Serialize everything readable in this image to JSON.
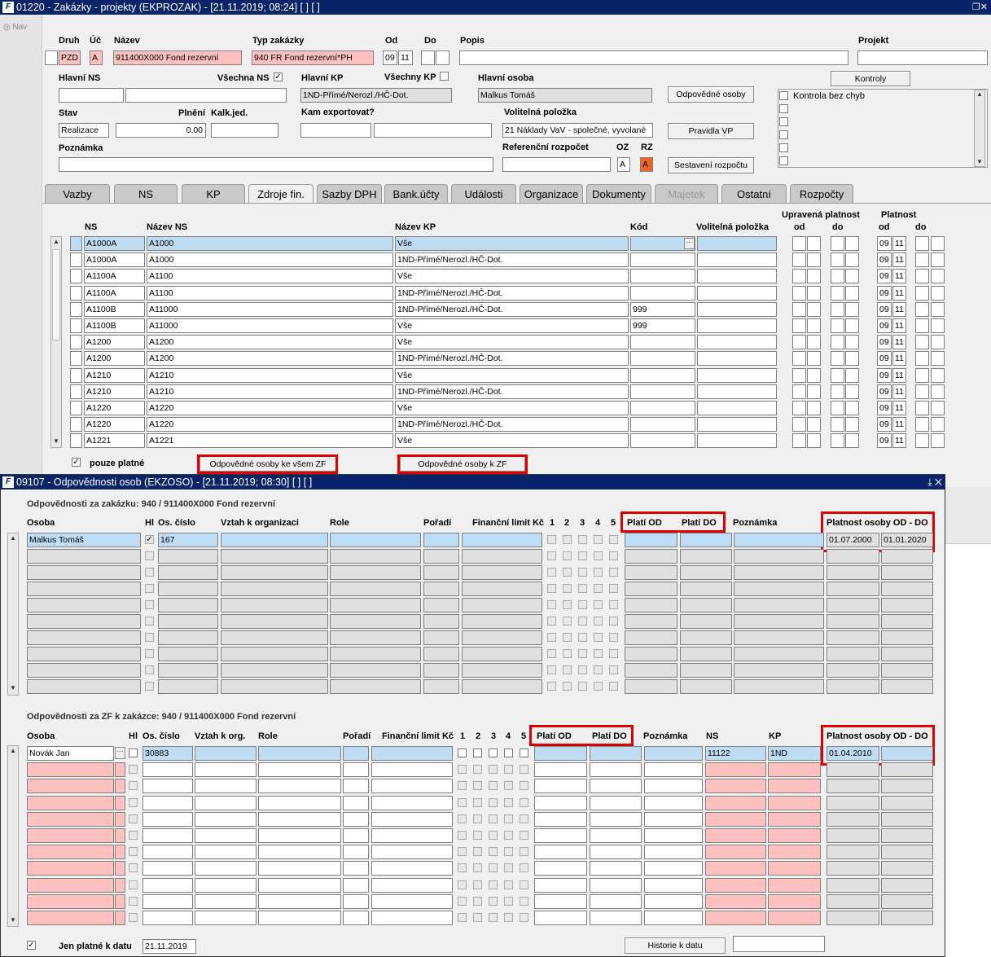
{
  "main_window": {
    "title": "01220 - Zakázky - projekty (EKPROZAK) - [21.11.2019; 08:24]  [ ]  [ ]",
    "nav": "Nav",
    "labels": {
      "druh": "Druh",
      "uc": "Úč",
      "nazev": "Název",
      "typ": "Typ zakázky",
      "od": "Od",
      "do": "Do",
      "popis": "Popis",
      "projekt": "Projekt",
      "hlavni_ns": "Hlavní NS",
      "vsechna_ns": "Všechna NS",
      "hlavni_kp": "Hlavní KP",
      "vsechny_kp": "Všechny KP",
      "hlavni_osoba": "Hlavní osoba",
      "stav": "Stav",
      "plneni": "Plnění",
      "kalk": "Kalk.jed.",
      "kam": "Kam exportovat?",
      "volitelna": "Volitelná položka",
      "poznamka": "Poznámka",
      "ref": "Referenční rozpočet",
      "oz": "OZ",
      "rz": "RZ",
      "kontrola": "Kontrola bez chyb",
      "pouze": "pouze platné"
    },
    "values": {
      "druh": "PZD",
      "uc": "A",
      "nazev": "911400X000 Fond rezervní",
      "typ": "940 FR Fond rezervní*PH",
      "od_d": "09",
      "od_m": "11",
      "hlavni_kp": "1ND-Přímé/Nerozl./HČ-Dot.",
      "hlavni_osoba": "Malkus Tomáš",
      "stav": "Realizace",
      "plneni": "0.00",
      "volitelna": "21 Náklady VaV - společné, vyvolané",
      "oz": "A",
      "rz": "A"
    },
    "buttons": {
      "kontroly": "Kontroly",
      "odpovedne": "Odpovědné osoby",
      "pravidla": "Pravidla VP",
      "sestaveni": "Sestavení rozpočtu",
      "k_vsem": "Odpovědné osoby ke všem ZF",
      "k_zf": "Odpovědné osoby k ZF"
    },
    "tabs": [
      "Vazby",
      "NS",
      "KP",
      "Zdroje fin.",
      "Sazby DPH",
      "Bank.účty",
      "Události",
      "Organizace",
      "Dokumenty",
      "Majetek",
      "Ostatní",
      "Rozpočty"
    ],
    "grid_headers": {
      "ns": "NS",
      "nazev_ns": "Název NS",
      "nazev_kp": "Název KP",
      "kod": "Kód",
      "vol": "Volitelná položka",
      "upr": "Upravená platnost",
      "od": "od",
      "do": "do",
      "plat": "Platnost",
      "od2": "od",
      "do2": "do"
    },
    "rows": [
      {
        "ns": "A1000A",
        "nns": "A1000",
        "kp": "Vše",
        "kod": "",
        "d": "09",
        "m": "11"
      },
      {
        "ns": "A1000A",
        "nns": "A1000",
        "kp": "1ND-Přímé/Nerozl./HČ-Dot.",
        "kod": "",
        "d": "09",
        "m": "11"
      },
      {
        "ns": "A1100A",
        "nns": "A1100",
        "kp": "Vše",
        "kod": "",
        "d": "09",
        "m": "11"
      },
      {
        "ns": "A1100A",
        "nns": "A1100",
        "kp": "1ND-Přímé/Nerozl./HČ-Dot.",
        "kod": "",
        "d": "09",
        "m": "11"
      },
      {
        "ns": "A1100B",
        "nns": "A11000",
        "kp": "1ND-Přímé/Nerozl./HČ-Dot.",
        "kod": "999",
        "d": "09",
        "m": "11"
      },
      {
        "ns": "A1100B",
        "nns": "A11000",
        "kp": "Vše",
        "kod": "999",
        "d": "09",
        "m": "11"
      },
      {
        "ns": "A1200",
        "nns": "A1200",
        "kp": "Vše",
        "kod": "",
        "d": "09",
        "m": "11"
      },
      {
        "ns": "A1200",
        "nns": "A1200",
        "kp": "1ND-Přímé/Nerozl./HČ-Dot.",
        "kod": "",
        "d": "09",
        "m": "11"
      },
      {
        "ns": "A1210",
        "nns": "A1210",
        "kp": "Vše",
        "kod": "",
        "d": "09",
        "m": "11"
      },
      {
        "ns": "A1210",
        "nns": "A1210",
        "kp": "1ND-Přímé/Nerozl./HČ-Dot.",
        "kod": "",
        "d": "09",
        "m": "11"
      },
      {
        "ns": "A1220",
        "nns": "A1220",
        "kp": "Vše",
        "kod": "",
        "d": "09",
        "m": "11"
      },
      {
        "ns": "A1220",
        "nns": "A1220",
        "kp": "1ND-Přímé/Nerozl./HČ-Dot.",
        "kod": "",
        "d": "09",
        "m": "11"
      },
      {
        "ns": "A1221",
        "nns": "A1221",
        "kp": "Vše",
        "kod": "",
        "d": "09",
        "m": "11"
      }
    ]
  },
  "dialog": {
    "title": "09107 - Odpovědnosti osob (EKZOSO) - [21.11.2019; 08:30]  [ ]  [ ]",
    "sec1": "Odpovědnosti za zakázku: 940 / 911400X000 Fond rezervní",
    "h1": {
      "osoba": "Osoba",
      "hl": "Hl",
      "cislo": "Os. číslo",
      "vztah": "Vztah k organizaci",
      "role": "Role",
      "poradi": "Pořadí",
      "limit": "Finanční limit Kč",
      "n1": "1",
      "n2": "2",
      "n3": "3",
      "n4": "4",
      "n5": "5",
      "od": "Platí OD",
      "do": "Platí DO",
      "pozn": "Poznámka",
      "plat": "Platnost osoby OD - DO"
    },
    "r1": {
      "osoba": "Malkus Tomáš",
      "cislo": "167",
      "od": "01.07.2000",
      "do": "01.01.2020"
    },
    "sec2": "Odpovědnosti za ZF k zakázce: 940 / 911400X000 Fond rezervní",
    "h2": {
      "osoba": "Osoba",
      "hl": "Hl",
      "cislo": "Os. číslo",
      "vztah": "Vztah k org.",
      "role": "Role",
      "poradi": "Pořadí",
      "limit": "Finanční limit Kč",
      "n1": "1",
      "n2": "2",
      "n3": "3",
      "n4": "4",
      "n5": "5",
      "od": "Platí OD",
      "do": "Platí DO",
      "pozn": "Poznámka",
      "ns": "NS",
      "kp": "KP",
      "plat": "Platnost osoby OD - DO"
    },
    "r2": {
      "osoba": "Novák Jan",
      "cislo": "30883",
      "ns": "11122",
      "kp": "1ND",
      "od": "01.04.2010"
    },
    "jen": "Jen platné k datu",
    "datum": "21.11.2019",
    "historie": "Historie k datu"
  }
}
